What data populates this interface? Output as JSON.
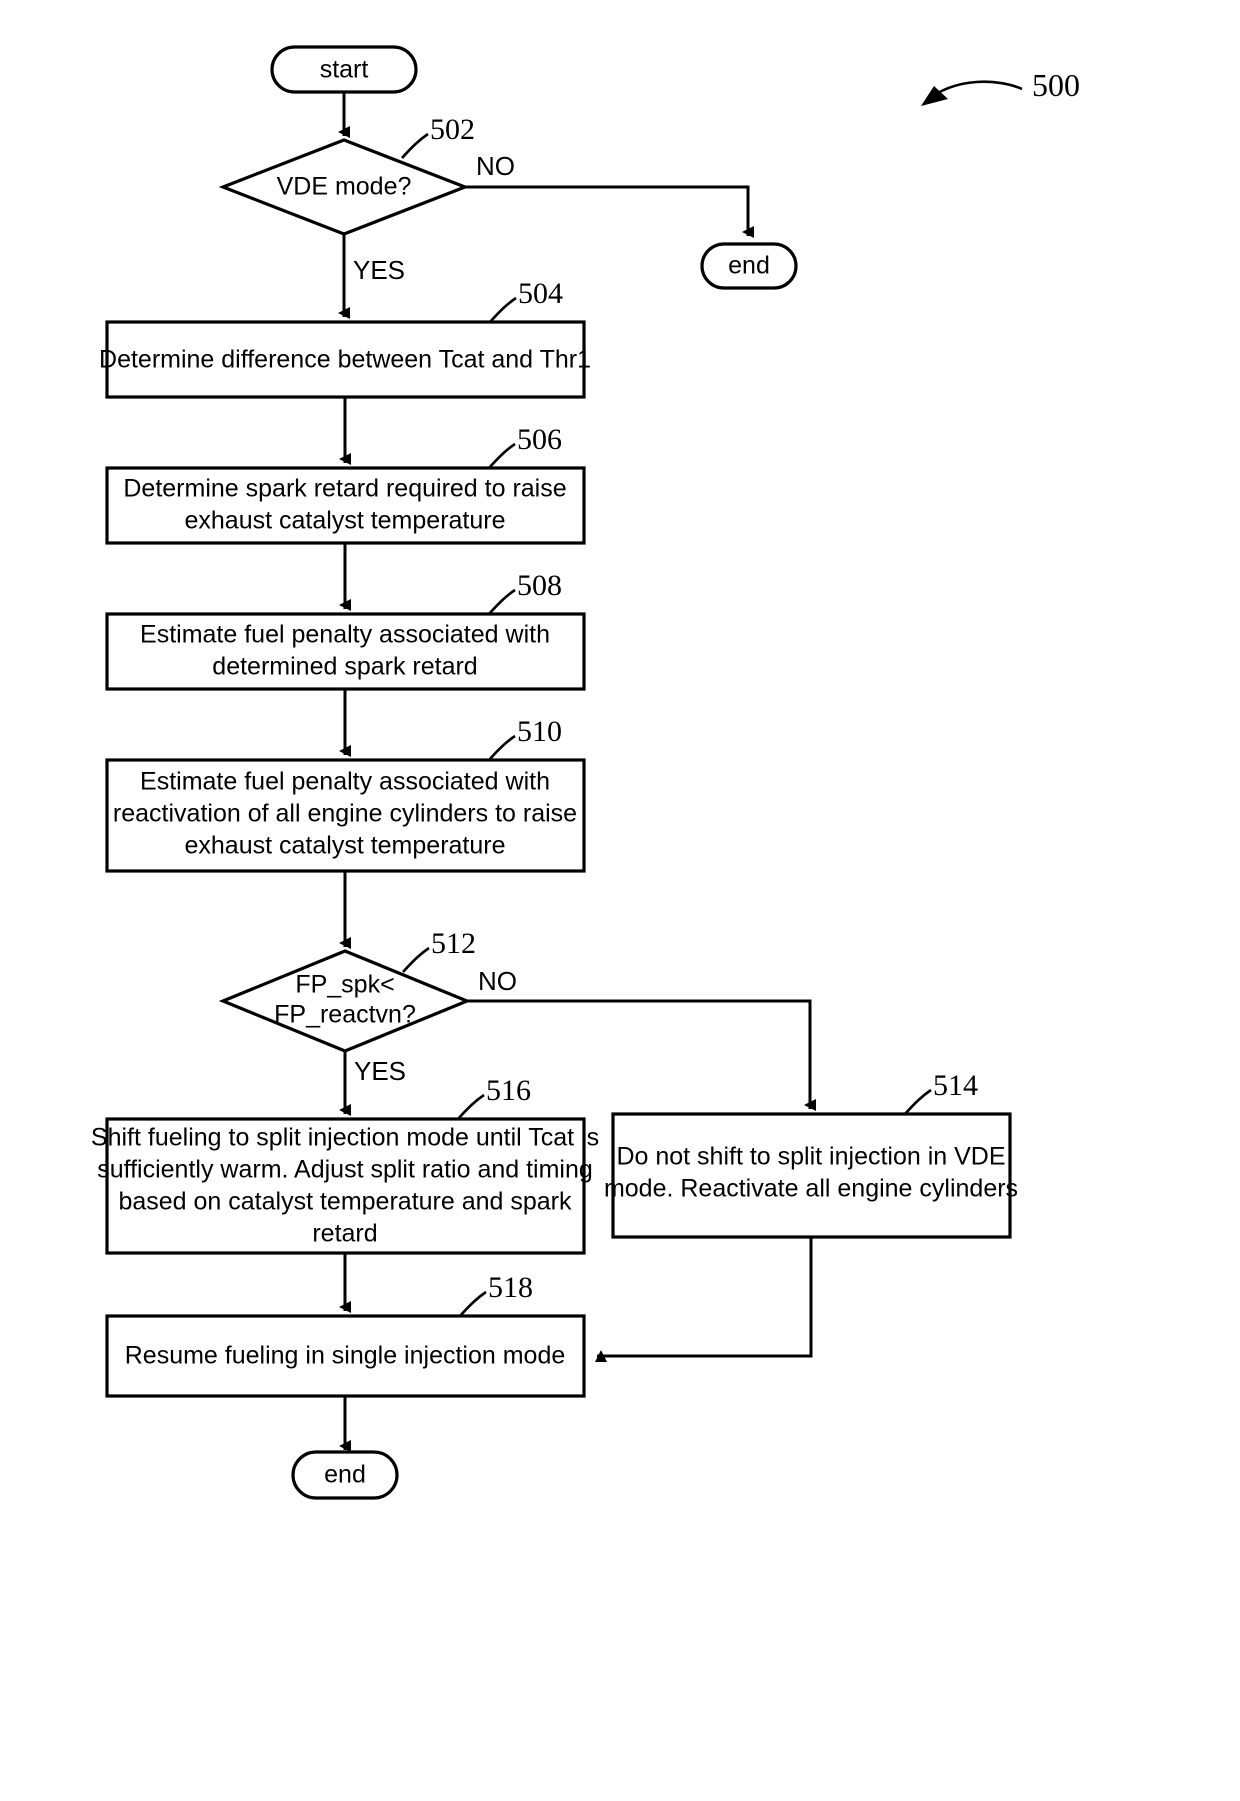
{
  "figure": {
    "number": "500",
    "type": "flowchart"
  },
  "terminators": {
    "start": "start",
    "end_no_branch": "end",
    "end_bottom": "end"
  },
  "decisions": [
    {
      "ref": "502",
      "line1": "VDE mode?",
      "line2": "",
      "yes_label": "YES",
      "no_label": "NO"
    },
    {
      "ref": "512",
      "line1": "FP_spk<",
      "line2": "FP_reactvn?",
      "yes_label": "YES",
      "no_label": "NO"
    }
  ],
  "processes": [
    {
      "ref": "504",
      "lines": [
        "Determine difference between Tcat and Thr1"
      ]
    },
    {
      "ref": "506",
      "lines": [
        "Determine spark retard required to raise",
        "exhaust catalyst temperature"
      ]
    },
    {
      "ref": "508",
      "lines": [
        "Estimate fuel penalty associated with",
        "determined spark retard"
      ]
    },
    {
      "ref": "510",
      "lines": [
        "Estimate fuel penalty associated with",
        "reactivation of all engine cylinders to raise",
        "exhaust catalyst temperature"
      ]
    },
    {
      "ref": "516",
      "lines": [
        "Shift fueling to split injection mode until Tcat is",
        "sufficiently warm.  Adjust split ratio and timing",
        "based on catalyst temperature and spark",
        "retard"
      ]
    },
    {
      "ref": "514",
      "lines": [
        "Do not shift to split injection in VDE",
        "mode. Reactivate all engine cylinders"
      ]
    },
    {
      "ref": "518",
      "lines": [
        "Resume fueling in single injection mode"
      ]
    }
  ],
  "colors": {
    "stroke": "#000000",
    "fill": "#ffffff",
    "background": "#ffffff"
  }
}
